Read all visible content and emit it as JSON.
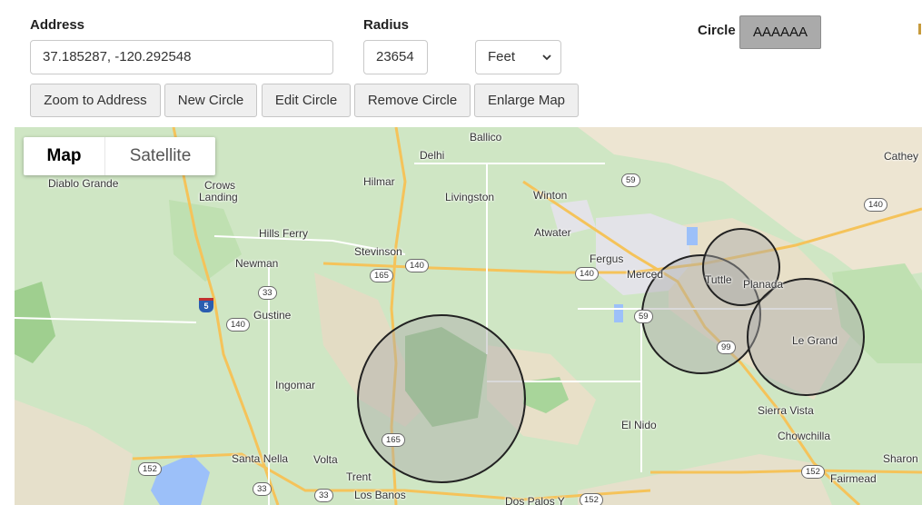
{
  "form": {
    "address_label": "Address",
    "address_value": "37.185287, -120.292548",
    "radius_label": "Radius",
    "radius_value": "23654",
    "unit_selected": "Feet",
    "circle_label": "Circle",
    "circle_color_value": "AAAAAA",
    "circle_color_hex": "#aaaaaa"
  },
  "buttons": {
    "zoom": "Zoom to Address",
    "new_circle": "New Circle",
    "edit_circle": "Edit Circle",
    "remove_circle": "Remove Circle",
    "enlarge_map": "Enlarge Map"
  },
  "map": {
    "type_map": "Map",
    "type_satellite": "Satellite",
    "places": {
      "ballico": "Ballico",
      "delhi": "Delhi",
      "cathey": "Cathey",
      "diablo_grande": "Diablo Grande",
      "crows": "Crows",
      "landing": "Landing",
      "hilmar": "Hilmar",
      "livingston": "Livingston",
      "winton": "Winton",
      "hills_ferry": "Hills Ferry",
      "atwater": "Atwater",
      "stevinson": "Stevinson",
      "fergus": "Fergus",
      "newman": "Newman",
      "merced": "Merced",
      "tuttle": "Tuttle",
      "planada": "Planada",
      "gustine": "Gustine",
      "le_grand": "Le Grand",
      "ingomar": "Ingomar",
      "el_nido": "El Nido",
      "sierra_vista": "Sierra Vista",
      "chowchilla": "Chowchilla",
      "santa_nella": "Santa Nella",
      "volta": "Volta",
      "sharon": "Sharon",
      "trent": "Trent",
      "fairmead": "Fairmead",
      "los_banos": "Los Banos",
      "dos_palos": "Dos Palos Y"
    },
    "shields": {
      "r59a": "59",
      "r140a": "140",
      "r165": "165",
      "r140b": "140",
      "r140c": "140",
      "r33a": "33",
      "r140d": "140",
      "r59b": "59",
      "r99": "99",
      "r165b": "165",
      "r152a": "152",
      "r33b": "33",
      "r33c": "33",
      "r152b": "152",
      "r152c": "152",
      "i5": "5"
    },
    "circle_colors": {
      "stroke": "#222222",
      "fill": "#aaaaaa"
    }
  }
}
